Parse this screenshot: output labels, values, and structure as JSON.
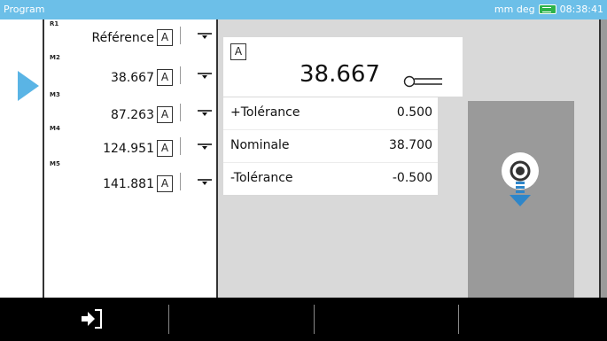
{
  "titlebar": {
    "title": "Program",
    "units": "mm deg",
    "time": "08:38:41",
    "battery_color": "#2db34a"
  },
  "measurements": [
    {
      "tag": "R1",
      "value": "Référence",
      "mode": "A"
    },
    {
      "tag": "M2",
      "value": "38.667",
      "mode": "A"
    },
    {
      "tag": "M3",
      "value": "87.263",
      "mode": "A"
    },
    {
      "tag": "M4",
      "value": "124.951",
      "mode": "A"
    },
    {
      "tag": "M5",
      "value": "141.881",
      "mode": "A"
    }
  ],
  "current_index": 1,
  "detail": {
    "mode": "A",
    "value": "38.667",
    "tolerances": [
      {
        "label": "+Tolérance",
        "value": "0.500"
      },
      {
        "label": "Nominale",
        "value": "38.700"
      },
      {
        "label": "-Tolérance",
        "value": "-0.500"
      }
    ]
  },
  "icons": {
    "current_marker": "triangle-right-icon",
    "probe": "probe-icon",
    "gauge_marker": "probe-tip-down-icon",
    "exit": "exit-icon",
    "row_control": "tray-down-icon"
  },
  "colors": {
    "title_bar": "#6cbfe8",
    "accent": "#5ab4e5",
    "gauge": "#9a9a9a"
  }
}
